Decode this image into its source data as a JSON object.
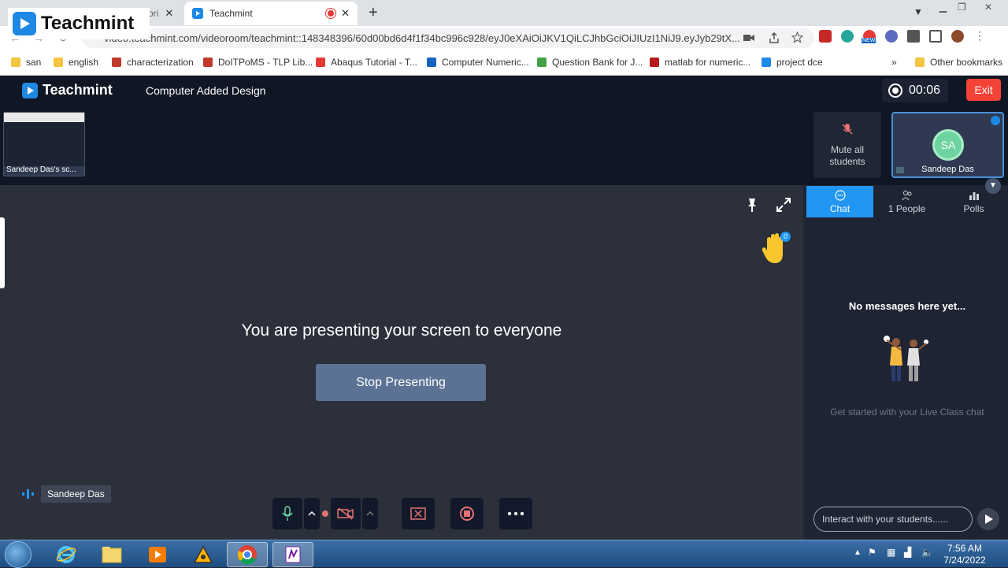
{
  "browser": {
    "tabs": [
      {
        "label": "ori"
      },
      {
        "label": "Teachmint"
      }
    ],
    "url": "video.teachmint.com/videoroom/teachmint::148348396/60d00bd6d4f1f34bc996c928/eyJ0eXAiOiJKV1QiLCJhbGciOiJIUzI1NiJ9.eyJyb29tX...",
    "bookmarks": [
      "san",
      "english",
      "characterization",
      "DoITPoMS - TLP Lib...",
      "Abaqus Tutorial - T...",
      "Computer Numeric...",
      "Question Bank for J...",
      "matlab for numeric...",
      "project dce",
      "Other bookmarks"
    ],
    "bookmarks_more": "»",
    "ext_new_badge": "NEW"
  },
  "overlay_logo": "Teachmint",
  "app": {
    "logo_text": "Teachmint",
    "class_title": "Computer Added Design",
    "timer": "00:06",
    "exit_label": "Exit"
  },
  "thumbnail": {
    "label": "Sandeep Das's sc..."
  },
  "mute_all_label": "Mute all students",
  "participant": {
    "initials": "SA",
    "name": "Sandeep Das"
  },
  "stage": {
    "presenting_message": "You are presenting your screen to everyone",
    "stop_button": "Stop Presenting",
    "speaker_name": "Sandeep Das",
    "hand_count": "0"
  },
  "panel": {
    "tabs": [
      {
        "label": "Chat",
        "icon": "chat-icon"
      },
      {
        "label": "1 People",
        "icon": "people-icon"
      },
      {
        "label": "Polls",
        "icon": "polls-icon"
      }
    ],
    "empty_title": "No messages here yet...",
    "empty_subtitle": "Get started with your Live Class chat",
    "input_placeholder": "Interact with your students......"
  },
  "taskbar": {
    "time": "7:56 AM",
    "date": "7/24/2022"
  },
  "colors": {
    "accent": "#2196f3",
    "exit": "#f44336",
    "stop_button": "#5b7295",
    "avatar": "#6dd3a0"
  }
}
